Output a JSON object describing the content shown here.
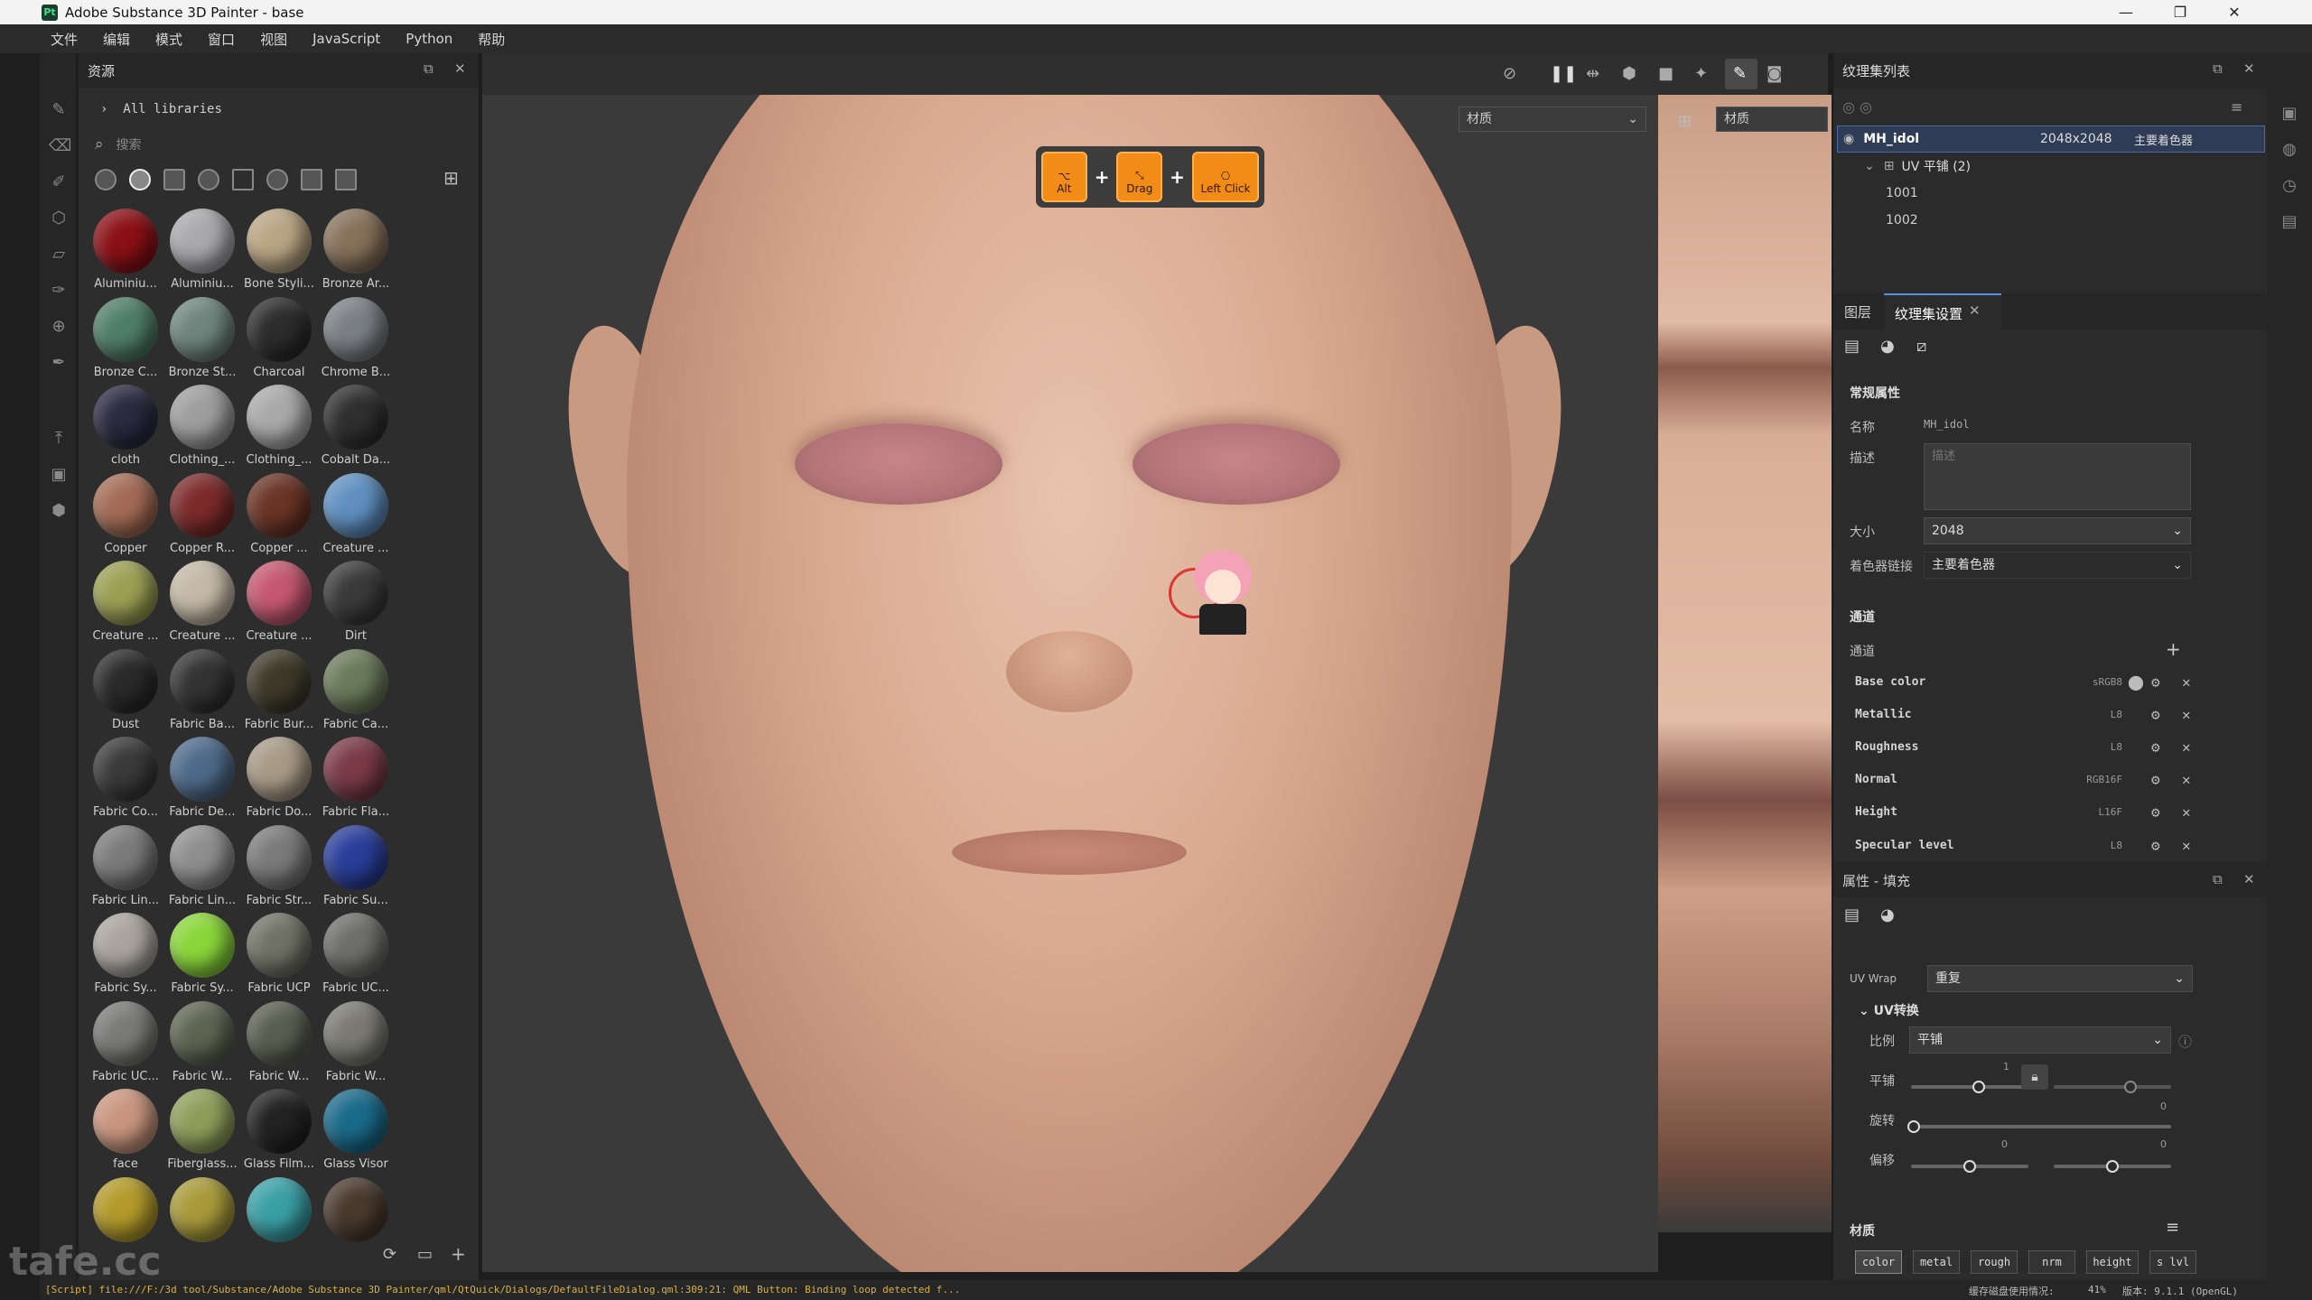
{
  "window": {
    "title": "Adobe Substance 3D Painter - base"
  },
  "menu": [
    "文件",
    "编辑",
    "模式",
    "窗口",
    "视图",
    "JavaScript",
    "Python",
    "帮助"
  ],
  "assets": {
    "title": "资源",
    "breadcrumb": "All libraries",
    "search_placeholder": "搜索",
    "materials": [
      {
        "label": "Aluminiu...",
        "color": "#8a1016"
      },
      {
        "label": "Aluminiu...",
        "color": "#a9a9ad"
      },
      {
        "label": "Bone Styli...",
        "color": "#b9a583"
      },
      {
        "label": "Bronze Ar...",
        "color": "#86715a"
      },
      {
        "label": "Bronze C...",
        "color": "#4f7e68"
      },
      {
        "label": "Bronze St...",
        "color": "#6f857d"
      },
      {
        "label": "Charcoal",
        "color": "#2c2c2c"
      },
      {
        "label": "Chrome B...",
        "color": "#7a7f84"
      },
      {
        "label": "cloth",
        "color": "#2a2a40"
      },
      {
        "label": "Clothing_...",
        "color": "#9e9e9e"
      },
      {
        "label": "Clothing_...",
        "color": "#a9a9a9"
      },
      {
        "label": "Cobalt Da...",
        "color": "#2f2f2f"
      },
      {
        "label": "Copper",
        "color": "#a36b55"
      },
      {
        "label": "Copper R...",
        "color": "#7c2a2a"
      },
      {
        "label": "Copper ...",
        "color": "#6a3426"
      },
      {
        "label": "Creature ...",
        "color": "#5f8fc0"
      },
      {
        "label": "Creature ...",
        "color": "#9aa053"
      },
      {
        "label": "Creature ...",
        "color": "#c4b8a6"
      },
      {
        "label": "Creature ...",
        "color": "#c55870"
      },
      {
        "label": "Dirt",
        "color": "#3a3a3a"
      },
      {
        "label": "Dust",
        "color": "#2a2a2a"
      },
      {
        "label": "Fabric Ba...",
        "color": "#333333"
      },
      {
        "label": "Fabric Bur...",
        "color": "#3e3a2a"
      },
      {
        "label": "Fabric Ca...",
        "color": "#6a7a5a"
      },
      {
        "label": "Fabric Co...",
        "color": "#3a3a3a"
      },
      {
        "label": "Fabric De...",
        "color": "#4e6a8a"
      },
      {
        "label": "Fabric Do...",
        "color": "#a89a86"
      },
      {
        "label": "Fabric Fla...",
        "color": "#7a3a46"
      },
      {
        "label": "Fabric Lin...",
        "color": "#7a7a7a"
      },
      {
        "label": "Fabric Lin...",
        "color": "#8e8e8e"
      },
      {
        "label": "Fabric Str...",
        "color": "#7a7a7a"
      },
      {
        "label": "Fabric Su...",
        "color": "#2a3e9a"
      },
      {
        "label": "Fabric Sy...",
        "color": "#a9a49e"
      },
      {
        "label": "Fabric Sy...",
        "color": "#8ad63a"
      },
      {
        "label": "Fabric UCP",
        "color": "#707266"
      },
      {
        "label": "Fabric UC...",
        "color": "#6e6e6a"
      },
      {
        "label": "Fabric UC...",
        "color": "#7a7a78"
      },
      {
        "label": "Fabric W...",
        "color": "#5e6452"
      },
      {
        "label": "Fabric W...",
        "color": "#5a5e50"
      },
      {
        "label": "Fabric W...",
        "color": "#7a7a72"
      },
      {
        "label": "face",
        "color": "#c9957e"
      },
      {
        "label": "Fiberglass...",
        "color": "#8e9e5a"
      },
      {
        "label": "Glass Film...",
        "color": "#222222"
      },
      {
        "label": "Glass Visor",
        "color": "#1a6a8a"
      },
      {
        "label": "",
        "color": "#b39a2a"
      },
      {
        "label": "",
        "color": "#a89a3a"
      },
      {
        "label": "",
        "color": "#3aa0a6"
      },
      {
        "label": "",
        "color": "#4a3a2e"
      }
    ]
  },
  "viewport": {
    "material_dropdown": "材质",
    "material_dropdown2": "材质",
    "keys": [
      {
        "glyph": "⌥",
        "label": "Alt"
      },
      {
        "glyph": "⤡",
        "label": "Drag"
      },
      {
        "glyph": "⎔",
        "label": "Left Click"
      }
    ]
  },
  "texture_sets": {
    "title": "纹理集列表",
    "selected": {
      "name": "MH_idol",
      "size": "2048x2048",
      "shader": "主要着色器"
    },
    "uv_group": "UV 平铺 (2)",
    "tiles": [
      "1001",
      "1002"
    ]
  },
  "settings": {
    "tab_layers": "图层",
    "tab_settings": "纹理集设置",
    "general_title": "常规属性",
    "name_label": "名称",
    "name_value": "MH_idol",
    "desc_label": "描述",
    "desc_placeholder": "描述",
    "size_label": "大小",
    "size_value": "2048",
    "shader_label": "着色器链接",
    "shader_value": "主要着色器",
    "channels_title": "通道",
    "channels_label": "通道",
    "channels": [
      {
        "name": "Base color",
        "format": "sRGB8"
      },
      {
        "name": "Metallic",
        "format": "L8"
      },
      {
        "name": "Roughness",
        "format": "L8"
      },
      {
        "name": "Normal",
        "format": "RGB16F"
      },
      {
        "name": "Height",
        "format": "L16F"
      },
      {
        "name": "Specular level",
        "format": "L8"
      }
    ]
  },
  "properties": {
    "title": "属性 - 填充",
    "uv_wrap_label": "UV Wrap",
    "uv_wrap_value": "重复",
    "uv_transform": "UV转换",
    "scale_label": "比例",
    "scale_value": "平铺",
    "tile_label": "平铺",
    "tile_value": "1",
    "rotate_label": "旋转",
    "rotate_value": "0",
    "offset_label": "偏移",
    "offset_value_1": "0",
    "offset_value_2": "0",
    "material_title": "材质",
    "material_buttons": [
      "color",
      "metal",
      "rough",
      "nrm",
      "height",
      "s lvl"
    ]
  },
  "status": {
    "log": "[Script] file:///F:/3d tool/Substance/Adobe Substance 3D Painter/qml/QtQuick/Dialogs/DefaultFileDialog.qml:309:21: QML Button: Binding loop detected f...",
    "cache": "缓存磁盘使用情况:",
    "percent": "41%",
    "version": "版本: 9.1.1 (OpenGL)"
  },
  "watermark": "tafe.cc"
}
